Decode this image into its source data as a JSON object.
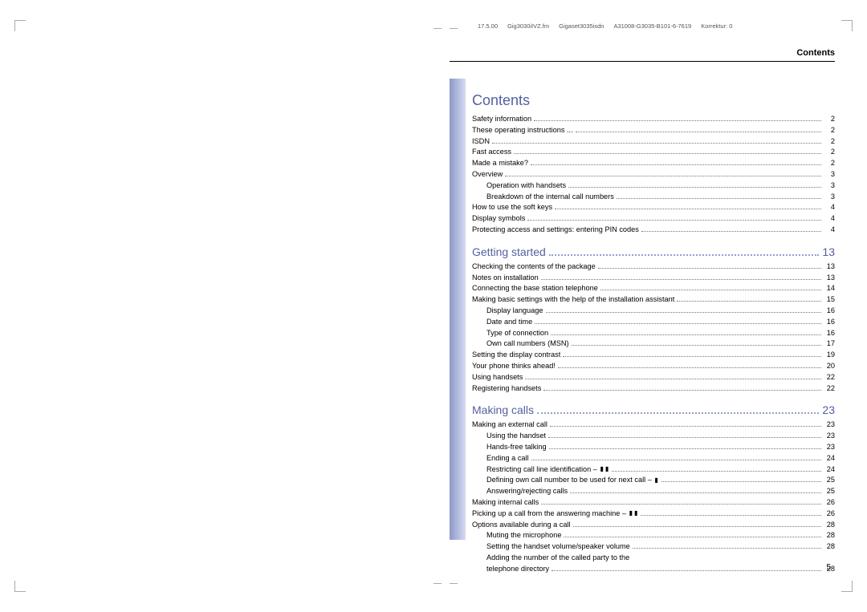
{
  "header": {
    "meta": [
      "17.5.00",
      "Gig3030iIVZ.fm",
      "Gigaset3035isdn",
      "A31008-G3035-B101-6-7619",
      "Korrektur: 0"
    ],
    "running_head": "Contents"
  },
  "toc": {
    "title": "Contents",
    "sections": [
      {
        "heading": null,
        "entries": [
          {
            "label": "Safety information",
            "page": "2",
            "level": 1
          },
          {
            "label": "These operating instructions ...",
            "page": "2",
            "level": 1
          },
          {
            "label": "ISDN",
            "page": "2",
            "level": 1
          },
          {
            "label": "Fast access",
            "page": "2",
            "level": 1
          },
          {
            "label": "Made a mistake?",
            "page": "2",
            "level": 1
          },
          {
            "label": "Overview",
            "page": "3",
            "level": 1
          },
          {
            "label": "Operation with handsets",
            "page": "3",
            "level": 2
          },
          {
            "label": "Breakdown of the internal call numbers",
            "page": "3",
            "level": 2
          },
          {
            "label": "How to use the soft keys",
            "page": "4",
            "level": 1
          },
          {
            "label": "Display symbols",
            "page": "4",
            "level": 1
          },
          {
            "label": "Protecting access and settings: entering PIN codes",
            "page": "4",
            "level": 1
          }
        ]
      },
      {
        "heading": {
          "label": "Getting started",
          "page": "13"
        },
        "entries": [
          {
            "label": "Checking the contents of the package",
            "page": "13",
            "level": 1
          },
          {
            "label": "Notes on installation",
            "page": "13",
            "level": 1
          },
          {
            "label": "Connecting the base station telephone",
            "page": "14",
            "level": 1
          },
          {
            "label": "Making basic settings with the help of the installation assistant",
            "page": "15",
            "level": 1
          },
          {
            "label": "Display language",
            "page": "16",
            "level": 2
          },
          {
            "label": "Date and time",
            "page": "16",
            "level": 2
          },
          {
            "label": "Type of connection",
            "page": "16",
            "level": 2
          },
          {
            "label": "Own call numbers (MSN)",
            "page": "17",
            "level": 2
          },
          {
            "label": "Setting the display contrast",
            "page": "19",
            "level": 1
          },
          {
            "label": "Your phone thinks ahead!",
            "page": "20",
            "level": 1
          },
          {
            "label": "Using handsets",
            "page": "22",
            "level": 1
          },
          {
            "label": "Registering handsets",
            "page": "22",
            "level": 1
          }
        ]
      },
      {
        "heading": {
          "label": "Making calls",
          "page": "23"
        },
        "entries": [
          {
            "label": "Making an external call",
            "page": "23",
            "level": 1
          },
          {
            "label": "Using the handset",
            "page": "23",
            "level": 2
          },
          {
            "label": "Hands-free talking",
            "page": "23",
            "level": 2
          },
          {
            "label": "Ending a call",
            "page": "24",
            "level": 2
          },
          {
            "label": "Restricting call line identification – ",
            "page": "24",
            "level": 2,
            "glyphs": [
              "▮",
              "▮"
            ]
          },
          {
            "label": "Defining own call number to be used for next call – ",
            "page": "25",
            "level": 2,
            "glyphs": [
              "▮"
            ]
          },
          {
            "label": "Answering/rejecting calls",
            "page": "25",
            "level": 2
          },
          {
            "label": "Making internal calls",
            "page": "26",
            "level": 1
          },
          {
            "label": "Picking up a call from the answering machine – ",
            "page": "26",
            "level": 1,
            "glyphs": [
              "▮",
              "▮"
            ]
          },
          {
            "label": "Options available during a call",
            "page": "28",
            "level": 1
          },
          {
            "label": "Muting the microphone",
            "page": "28",
            "level": 2
          },
          {
            "label": "Setting the handset volume/speaker volume",
            "page": "28",
            "level": 2
          },
          {
            "label": "Adding the number of the called party to the",
            "page": "",
            "level": 2,
            "nopage": true
          },
          {
            "label": "telephone directory",
            "page": "28",
            "level": 2
          }
        ]
      }
    ]
  },
  "page_number": "5"
}
